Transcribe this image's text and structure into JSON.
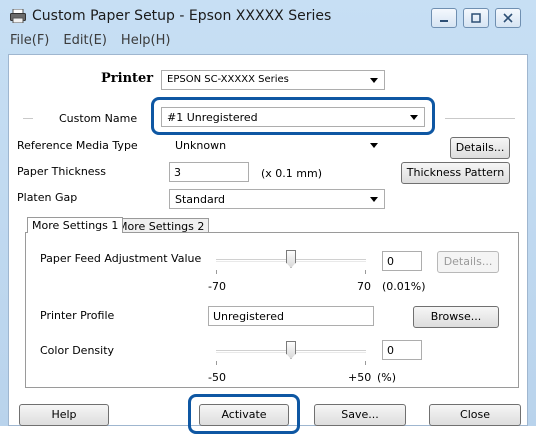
{
  "window": {
    "title": "Custom Paper Setup - Epson XXXXX Series",
    "accent_color": "#0e57a3"
  },
  "menu": [
    "File(F)",
    "Edit(E)",
    "Help(H)"
  ],
  "printer": {
    "label": "Printer",
    "value": "EPSON SC-XXXXX Series"
  },
  "custom_name": {
    "label": "Custom Name",
    "value": "#1 Unregistered"
  },
  "media_type": {
    "label": "Reference Media Type",
    "value": "Unknown",
    "details_button": "Details..."
  },
  "thickness": {
    "label": "Paper Thickness",
    "value": "3",
    "unit": "(x 0.1 mm)",
    "pattern_button": "Thickness Pattern"
  },
  "platen_gap": {
    "label": "Platen Gap",
    "value": "Standard"
  },
  "tabs": [
    "More Settings 1",
    "More Settings 2"
  ],
  "feed_adjust": {
    "label": "Paper Feed Adjustment Value",
    "value": "0",
    "details_button": "Details...",
    "min_label": "-70",
    "max_label": "70",
    "unit": "(0.01%)",
    "min": -70,
    "max": 70,
    "current": 0
  },
  "profile": {
    "label": "Printer Profile",
    "value": "Unregistered",
    "browse_button": "Browse..."
  },
  "color_density": {
    "label": "Color Density",
    "value": "0",
    "min_label": "-50",
    "max_label": "+50",
    "unit": "(%)",
    "min": -50,
    "max": 50,
    "current": 0
  },
  "bottom_buttons": {
    "help": "Help",
    "activate": "Activate",
    "save": "Save...",
    "close": "Close"
  }
}
